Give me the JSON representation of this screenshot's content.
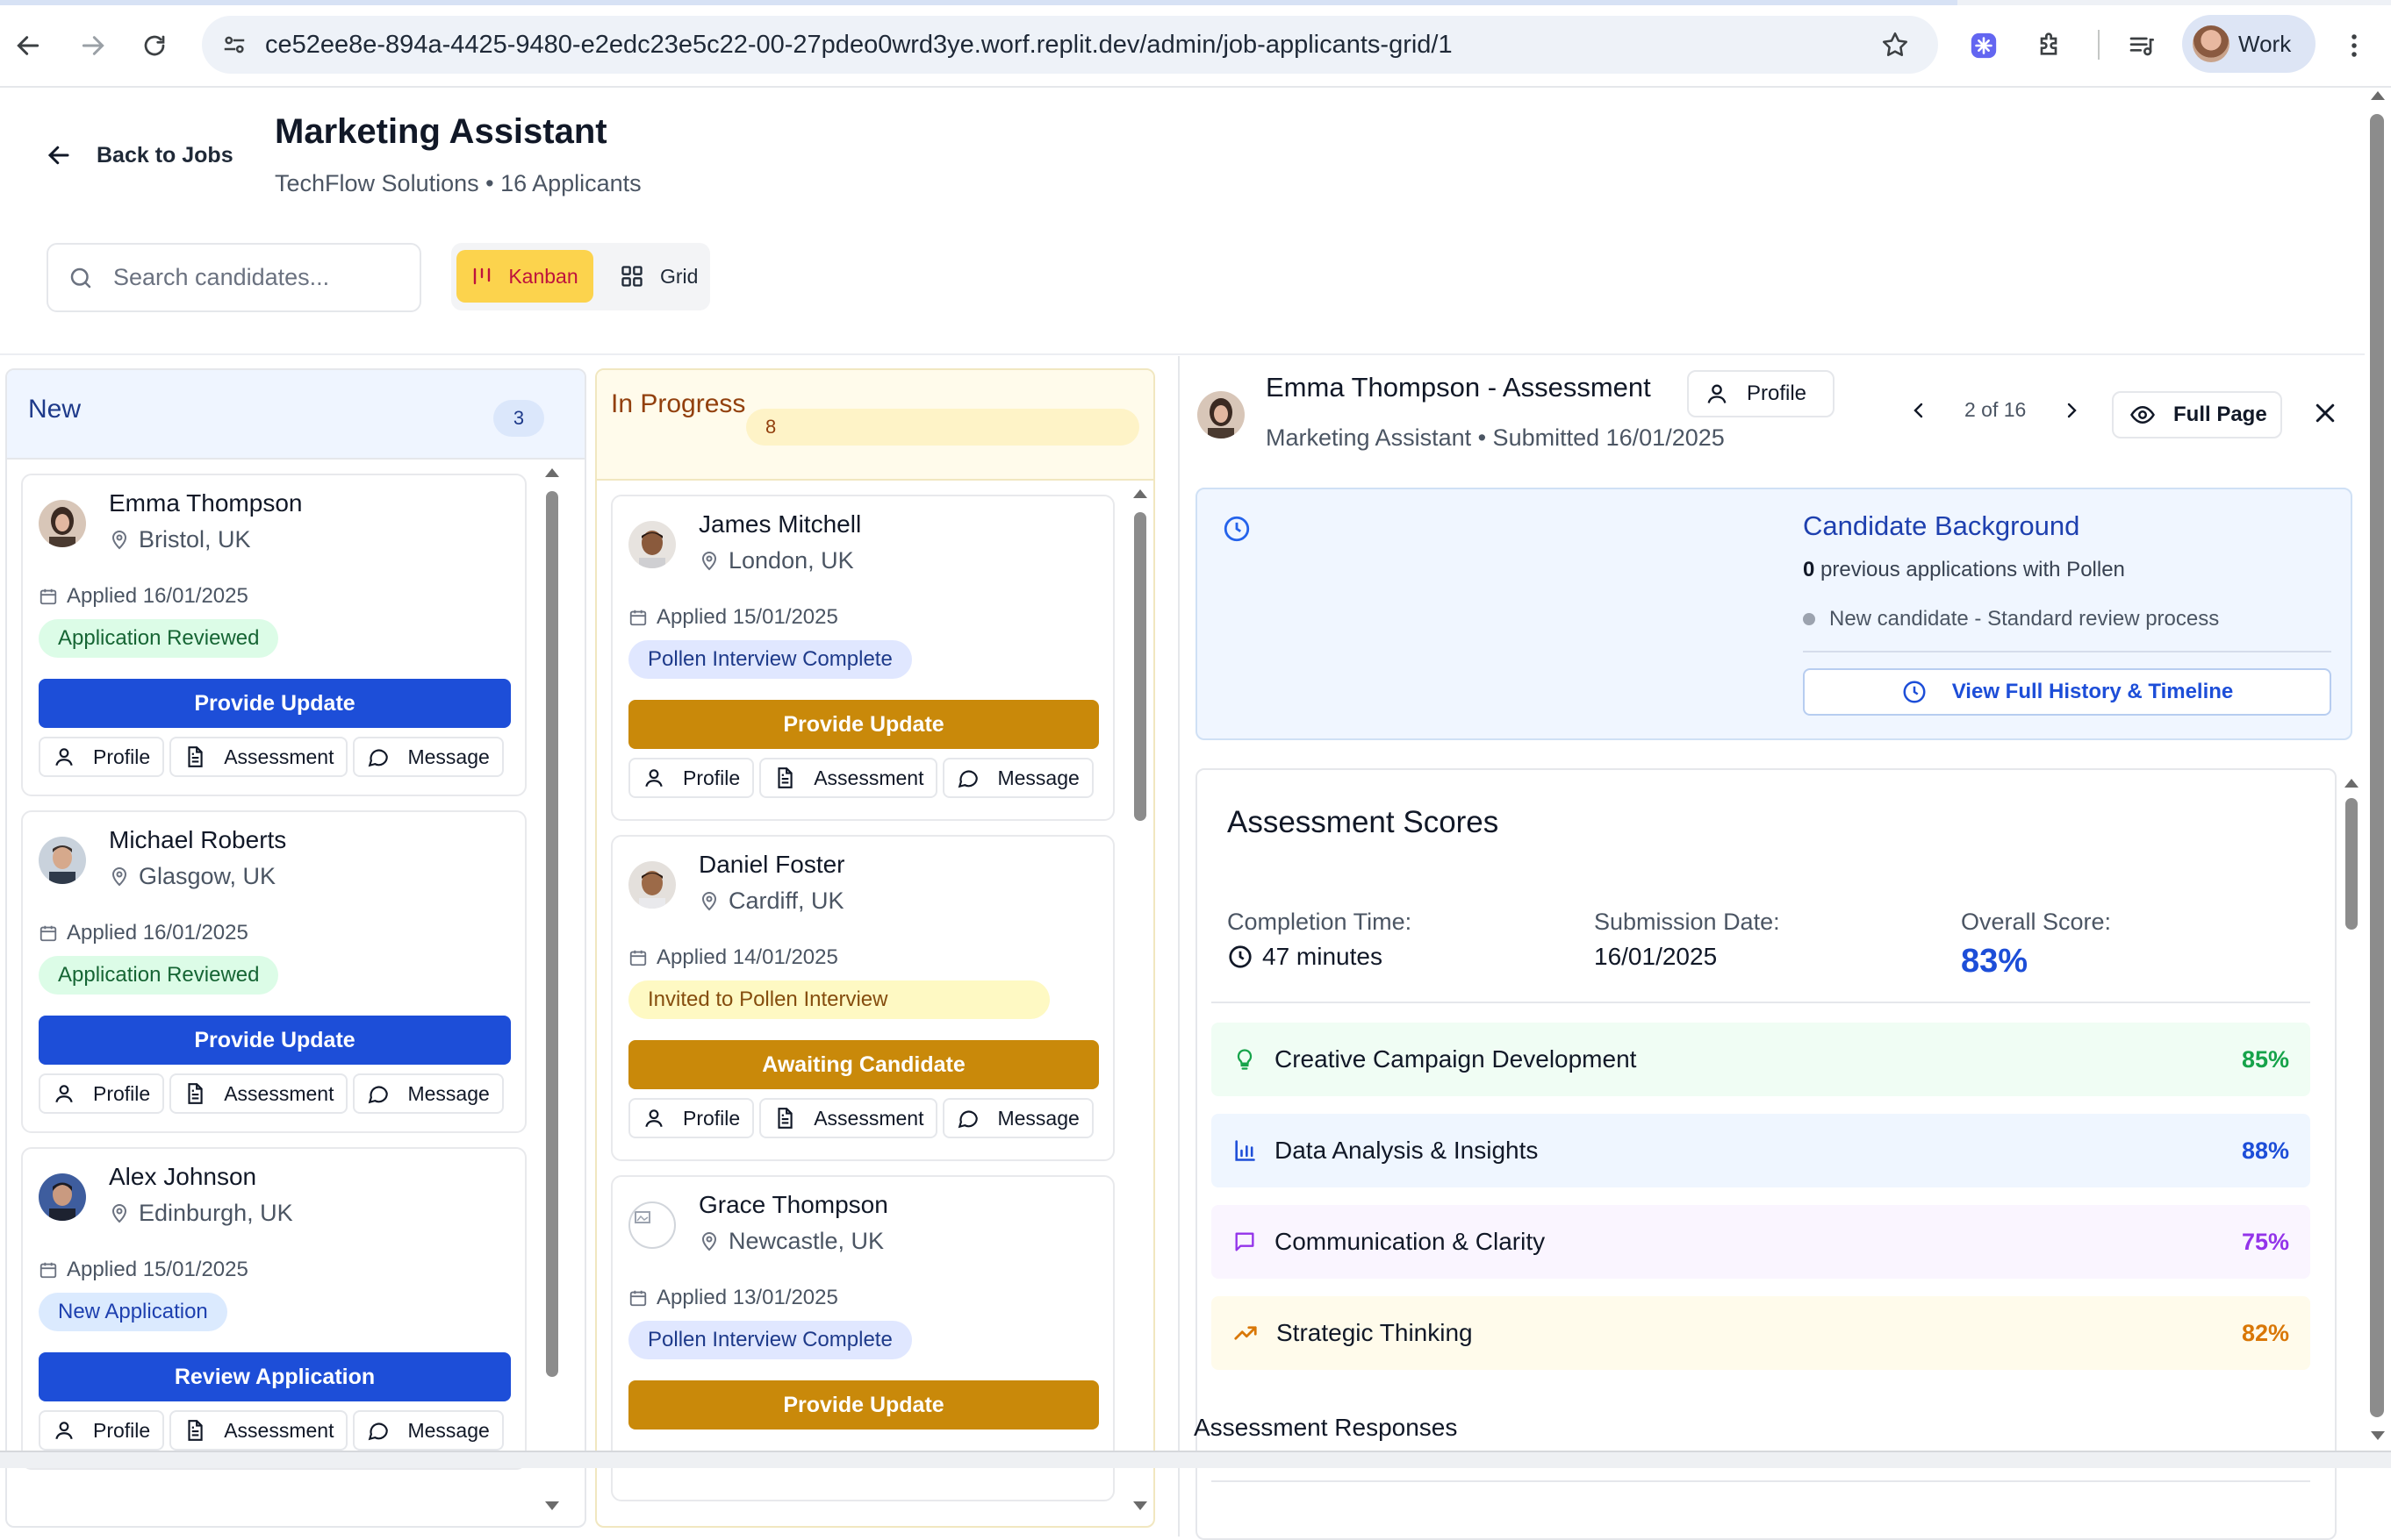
{
  "browser": {
    "url": "ce52ee8e-894a-4425-9480-e2edc23e5c22-00-27pdeo0wrd3ye.worf.replit.dev/admin/job-applicants-grid/1",
    "profile_label": "Work"
  },
  "header": {
    "back_label": "Back to Jobs",
    "title": "Marketing Assistant",
    "subtitle": "TechFlow Solutions • 16 Applicants"
  },
  "toolbar": {
    "search_placeholder": "Search candidates...",
    "view_kanban": "Kanban",
    "view_grid": "Grid",
    "active_view": "Kanban"
  },
  "columns": [
    {
      "title": "New",
      "count": "3",
      "cards": [
        {
          "name": "Emma Thompson",
          "location": "Bristol, UK",
          "applied": "Applied 16/01/2025",
          "status": "Application Reviewed",
          "action": "Provide Update"
        },
        {
          "name": "Michael Roberts",
          "location": "Glasgow, UK",
          "applied": "Applied 16/01/2025",
          "status": "Application Reviewed",
          "action": "Provide Update"
        },
        {
          "name": "Alex Johnson",
          "location": "Edinburgh, UK",
          "applied": "Applied 15/01/2025",
          "status": "New Application",
          "action": "Review Application"
        }
      ]
    },
    {
      "title": "In Progress",
      "count": "8",
      "cards": [
        {
          "name": "James Mitchell",
          "location": "London, UK",
          "applied": "Applied 15/01/2025",
          "status": "Pollen Interview Complete",
          "action": "Provide Update"
        },
        {
          "name": "Daniel Foster",
          "location": "Cardiff, UK",
          "applied": "Applied 14/01/2025",
          "status": "Invited to Pollen Interview",
          "action": "Awaiting Candidate"
        },
        {
          "name": "Grace Thompson",
          "location": "Newcastle, UK",
          "applied": "Applied 13/01/2025",
          "status": "Pollen Interview Complete",
          "action": "Provide Update"
        }
      ]
    }
  ],
  "card_actions": {
    "profile": "Profile",
    "assessment": "Assessment",
    "message": "Message"
  },
  "detail": {
    "title": "Emma Thompson - Assessment",
    "profile_button": "Profile",
    "subtitle": "Marketing Assistant • Submitted 16/01/2025",
    "pager": "2 of 16",
    "full_page": "Full Page",
    "background": {
      "heading": "Candidate Background",
      "previous_count": "0",
      "previous_text": "previous applications with Pollen",
      "status": "New candidate - Standard review process",
      "history_button": "View Full History & Timeline"
    },
    "scores": {
      "heading": "Assessment Scores",
      "completion_label": "Completion Time:",
      "completion_value": "47 minutes",
      "submission_label": "Submission Date:",
      "submission_value": "16/01/2025",
      "overall_label": "Overall Score:",
      "overall_value": "83%",
      "skills": [
        {
          "name": "Creative Campaign Development",
          "score": "85%",
          "icon": "lightbulb-icon"
        },
        {
          "name": "Data Analysis & Insights",
          "score": "88%",
          "icon": "bar-chart-icon"
        },
        {
          "name": "Communication & Clarity",
          "score": "75%",
          "icon": "message-square-icon"
        },
        {
          "name": "Strategic Thinking",
          "score": "82%",
          "icon": "trending-up-icon"
        }
      ]
    },
    "responses_heading": "Assessment Responses"
  },
  "colors": {
    "primary_blue": "#1d4ed8",
    "gold": "#c9890a",
    "kanban_active": "#fcd34d"
  }
}
